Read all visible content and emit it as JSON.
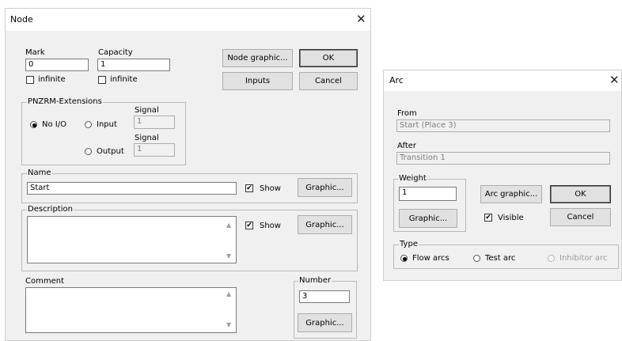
{
  "node_dialog": {
    "title": "Node",
    "close_glyph": "✕",
    "mark": {
      "label": "Mark",
      "value": "0",
      "infinite_label": "infinite",
      "infinite_checked": false
    },
    "capacity": {
      "label": "Capacity",
      "value": "1",
      "infinite_label": "infinite",
      "infinite_checked": false
    },
    "node_graphic_label": "Node graphic...",
    "ok_label": "OK",
    "inputs_label": "Inputs",
    "cancel_label": "Cancel",
    "pnzrm": {
      "group_label": "PNZRM-Extensions",
      "no_io_label": "No I/O",
      "input_label": "Input",
      "output_label": "Output",
      "selected": "No I/O",
      "signal_label_1": "Signal",
      "signal_value_1": "1",
      "signal_label_2": "Signal",
      "signal_value_2": "1"
    },
    "name": {
      "group_label": "Name",
      "value": "Start",
      "show_label": "Show",
      "show_checked": true,
      "graphic_label": "Graphic..."
    },
    "description": {
      "group_label": "Description",
      "value": "",
      "show_label": "Show",
      "show_checked": true,
      "graphic_label": "Graphic..."
    },
    "comment": {
      "label": "Comment",
      "value": ""
    },
    "number": {
      "group_label": "Number",
      "value": "3",
      "graphic_label": "Graphic..."
    }
  },
  "arc_dialog": {
    "title": "Arc",
    "close_glyph": "✕",
    "from_label": "From",
    "from_value": "Start (Place 3)",
    "after_label": "After",
    "after_value": "Transition 1",
    "weight": {
      "group_label": "Weight",
      "value": "1",
      "graphic_label": "Graphic..."
    },
    "arc_graphic_label": "Arc graphic...",
    "ok_label": "OK",
    "visible_label": "Visible",
    "visible_checked": true,
    "cancel_label": "Cancel",
    "type": {
      "group_label": "Type",
      "flow_label": "Flow arcs",
      "test_label": "Test arc",
      "inhibitor_label": "Inhibitor arc",
      "selected": "Flow arcs"
    }
  },
  "icons": {
    "check": "✔",
    "up_arrow": "▲",
    "down_arrow": "▼",
    "close": "close-x"
  }
}
